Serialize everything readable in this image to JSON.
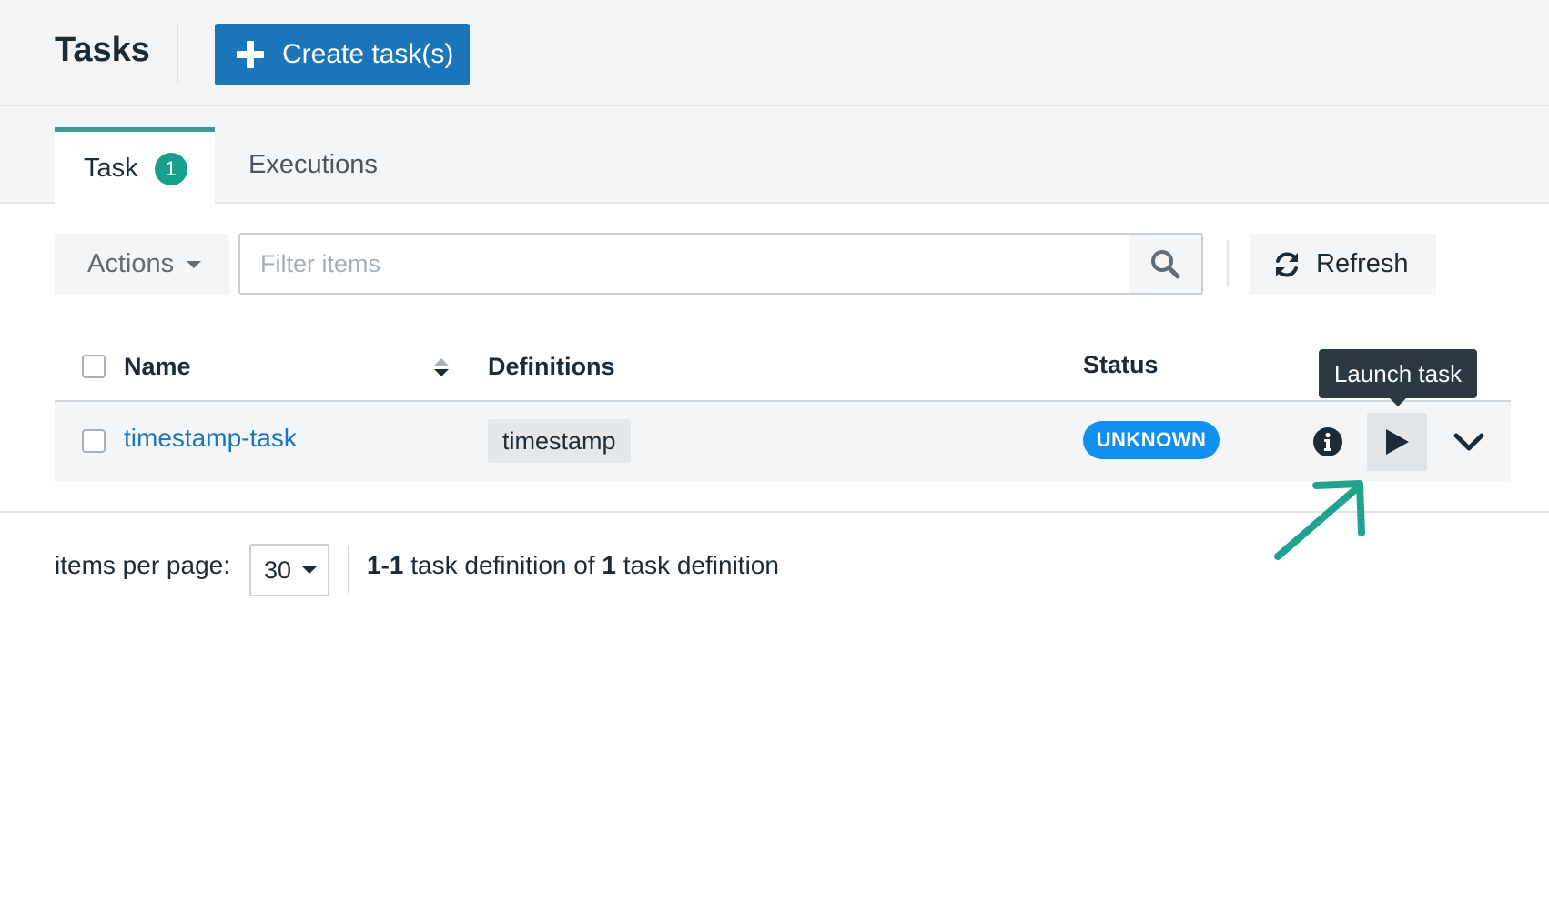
{
  "header": {
    "title": "Tasks",
    "create_label": "Create task(s)"
  },
  "tabs": [
    {
      "label": "Task",
      "badge": "1",
      "active": true
    },
    {
      "label": "Executions",
      "active": false
    }
  ],
  "toolbar": {
    "actions_label": "Actions",
    "filter_placeholder": "Filter items",
    "refresh_label": "Refresh"
  },
  "table": {
    "columns": [
      "Name",
      "Definitions",
      "Status"
    ],
    "rows": [
      {
        "name": "timestamp-task",
        "definition": "timestamp",
        "status": "UNKNOWN"
      }
    ]
  },
  "tooltip": "Launch task",
  "pagination": {
    "items_per_page_label": "items per page:",
    "items_per_page": "30",
    "range": "1-1",
    "text_mid": " task definition of ",
    "total": "1",
    "text_end": " task definition"
  },
  "colors": {
    "primary": "#1b76b9",
    "tab_accent": "#3e9c8f",
    "badge": "#16a08c",
    "status_unknown": "#0f8ff0",
    "annotation_arrow": "#1fa38d"
  },
  "icons": {
    "create": "plus-icon",
    "actions": "caret-down-icon",
    "search": "search-icon",
    "refresh": "refresh-icon",
    "sort": "sort-icon",
    "info": "info-icon",
    "launch": "play-icon",
    "expand": "chevron-down-icon",
    "annotation": "arrow-up-right-icon"
  }
}
